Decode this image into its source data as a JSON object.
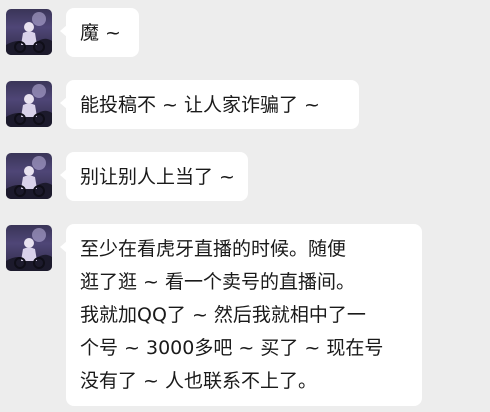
{
  "messages": [
    {
      "lines": [
        "魔 ~"
      ]
    },
    {
      "lines": [
        "能投稿不 ~ 让人家诈骗了 ~"
      ]
    },
    {
      "lines": [
        "别让别人上当了 ~"
      ]
    },
    {
      "lines": [
        "至少在看虎牙直播的时候。随便",
        "逛了逛 ~ 看一个卖号的直播间。",
        "我就加QQ了 ~ 然后我就相中了一",
        "个号 ~ 3000多吧 ~ 买了 ~ 现在号",
        "没有了 ~ 人也联系不上了。"
      ]
    }
  ],
  "colors": {
    "background": "#ededed",
    "bubble": "#ffffff",
    "text": "#1a1a1a"
  },
  "icons": {
    "avatar": "avatar-icon"
  }
}
